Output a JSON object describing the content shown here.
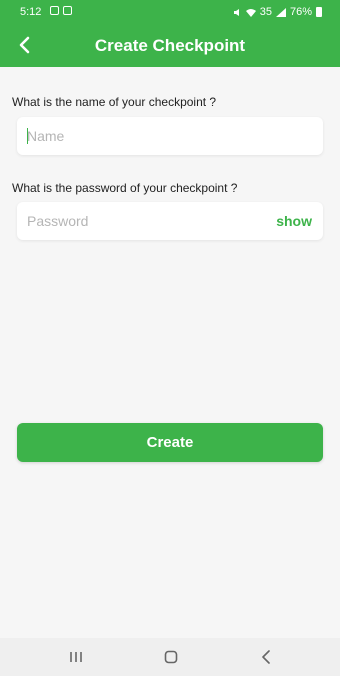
{
  "colors": {
    "accent": "#3db34a",
    "background": "#f6f6f6",
    "nav_bar": "#efefef"
  },
  "status_bar": {
    "time": "5:12",
    "indicators": "35",
    "battery": "76%"
  },
  "app_bar": {
    "title": "Create Checkpoint",
    "back_icon": "chevron-left-icon"
  },
  "form": {
    "name_question": "What is the name of your checkpoint ?",
    "name_placeholder": "Name",
    "name_value": "",
    "password_question": "What is the password of your checkpoint ?",
    "password_placeholder": "Password",
    "password_value": "",
    "show_label": "show"
  },
  "actions": {
    "create_label": "Create"
  },
  "system_nav": {
    "recents_icon": "recents-icon",
    "home_icon": "home-icon",
    "back_icon": "back-icon"
  }
}
